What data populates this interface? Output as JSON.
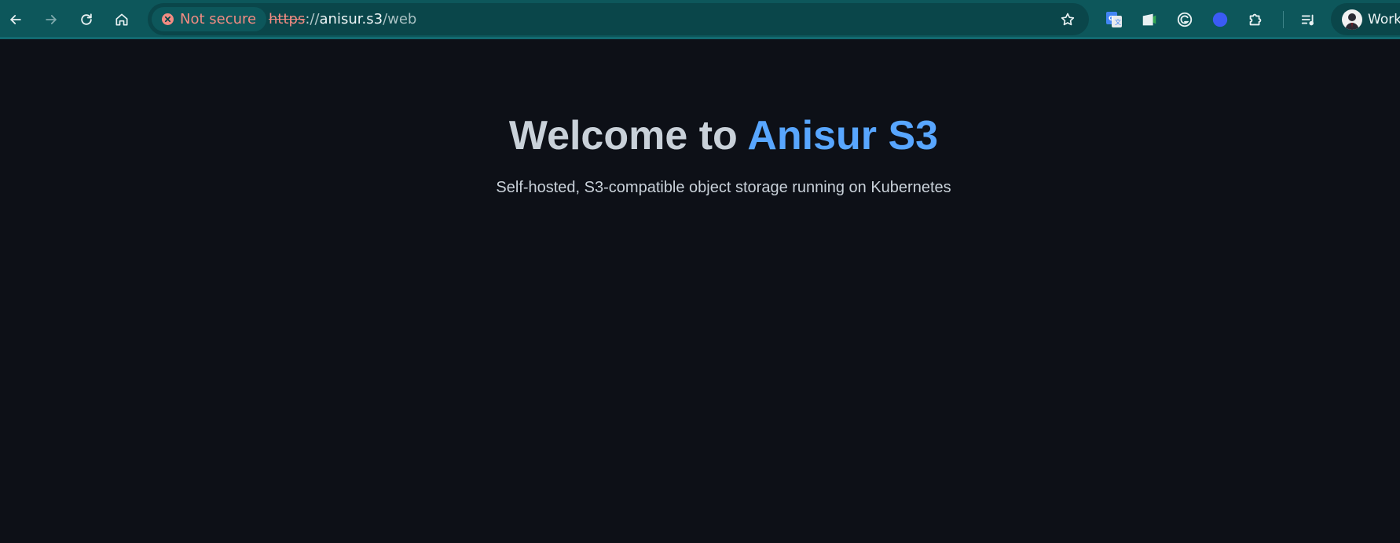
{
  "browser": {
    "security_chip": "Not secure",
    "url_scheme": "https",
    "url_separator": "://",
    "url_host": "anisur.s3",
    "url_path": "/web",
    "nav": [
      "back-icon",
      "forward-icon",
      "reload-icon",
      "home-icon"
    ],
    "extensions": [
      "google-translate-icon",
      "extension-icon",
      "grammarly-icon",
      "blue-circle-extension-icon",
      "extensions-puzzle-icon",
      "reading-list-icon"
    ],
    "profile_label": "Work"
  },
  "page": {
    "heading_prefix": "Welcome to ",
    "heading_brand": "Anisur S3",
    "subtitle": "Self-hosted, S3-compatible object storage running on Kubernetes"
  },
  "colors": {
    "toolbar": "#0d575b",
    "page_background": "#0d1017",
    "text": "#c9d1d9",
    "accent": "#58a6ff",
    "warning": "#f28b82"
  }
}
